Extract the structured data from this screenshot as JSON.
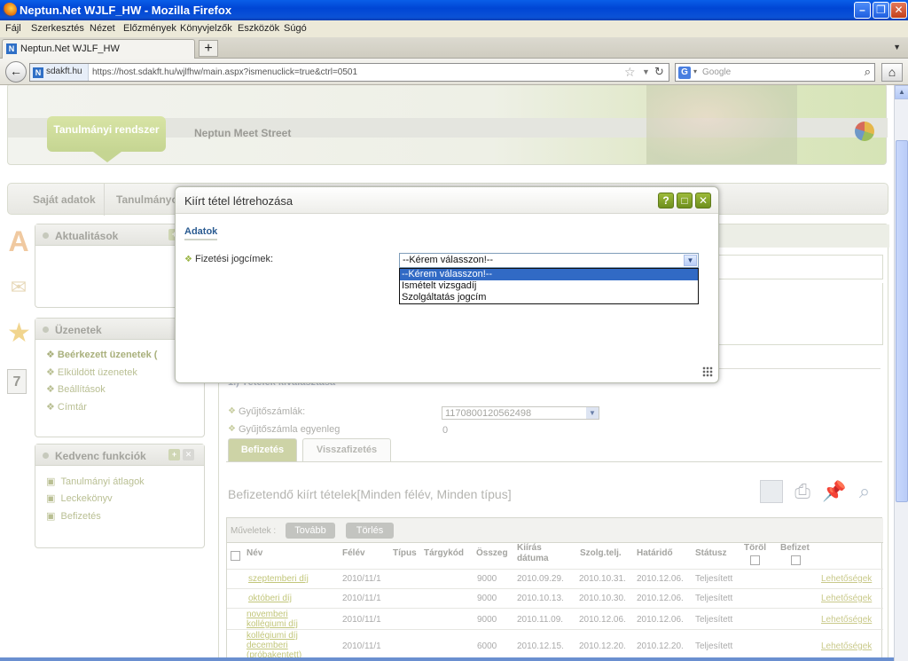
{
  "window": {
    "title": "Neptun.Net WJLF_HW - Mozilla Firefox"
  },
  "menu": [
    "Fájl",
    "Szerkesztés",
    "Nézet",
    "Előzmények",
    "Könyvjelzők",
    "Eszközök",
    "Súgó"
  ],
  "tab": {
    "label": "Neptun.Net WJLF_HW",
    "new_tab": "+"
  },
  "nav": {
    "site": "sdakft.hu",
    "url": "https://host.sdakft.hu/wjlfhw/main.aspx?ismenuclick=true&ctrl=0501",
    "search_engine": "G",
    "search_placeholder": "Google"
  },
  "banner": {
    "tab_active": "Tanulmányi rendszer",
    "tab_other": "Neptun Meet Street"
  },
  "mainnav": [
    "Saját adatok",
    "Tanulmányo"
  ],
  "sidebar": {
    "news_title": "Aktualitások",
    "messages_title": "Üzenetek",
    "messages_items": [
      "Beérkezett üzenetek (",
      "Elküldött üzenetek",
      "Beállítások",
      "Címtár"
    ],
    "fav_title": "Kedvenc funkciók",
    "fav_items": [
      "Tanulmányi átlagok",
      "Leckekönyv",
      "Befizetés"
    ],
    "calendar_day": "7"
  },
  "content": {
    "section_title": "1.) Tételek kiválasztása",
    "account_label": "Gyűjtőszámlák:",
    "account_value": "1170800120562498",
    "balance_label": "Gyűjtőszámla egyenleg",
    "balance_value": "0",
    "tabs": [
      "Befizetés",
      "Visszafizetés"
    ],
    "list_title": "Befizetendő kiírt tételek[Minden félév, Minden típus]",
    "ops_label": "Műveletek :",
    "ops_buttons": [
      "Tovább",
      "Törlés"
    ],
    "headers": [
      "Név",
      "Félév",
      "Típus",
      "Tárgykód",
      "Összeg",
      "Kiírás dátuma",
      "Szolg.telj.",
      "Határidő",
      "Státusz",
      "Töröl",
      "Befizet"
    ],
    "rows": [
      {
        "name": "szeptemberi díj",
        "term": "2010/11/1",
        "amount": "9000",
        "issued": "2010.09.29.",
        "service": "2010.10.31.",
        "deadline": "2010.12.06.",
        "status": "Teljesített",
        "more": "Lehetőségek"
      },
      {
        "name": "októberi díj",
        "term": "2010/11/1",
        "amount": "9000",
        "issued": "2010.10.13.",
        "service": "2010.10.30.",
        "deadline": "2010.12.06.",
        "status": "Teljesített",
        "more": "Lehetőségek"
      },
      {
        "name": "novemberi kollégiumi díj",
        "term": "2010/11/1",
        "amount": "9000",
        "issued": "2010.11.09.",
        "service": "2010.12.06.",
        "deadline": "2010.12.06.",
        "status": "Teljesített",
        "more": "Lehetőségek"
      },
      {
        "name": "kollégiumi díj decemberi (próbakentett)",
        "term": "2010/11/1",
        "amount": "6000",
        "issued": "2010.12.15.",
        "service": "2010.12.20.",
        "deadline": "2010.12.20.",
        "status": "Teljesített",
        "more": "Lehetőségek"
      }
    ]
  },
  "modal": {
    "title": "Kiírt tétel létrehozása",
    "section": "Adatok",
    "field_label": "Fizetési jogcímek:",
    "selected": "--Kérem válasszon!--",
    "options": [
      "--Kérem válasszon!--",
      "Ismételt vizsgadíj",
      "Szolgáltatás jogcím"
    ],
    "buttons": {
      "help": "?",
      "max": "□",
      "close": "✕"
    }
  }
}
